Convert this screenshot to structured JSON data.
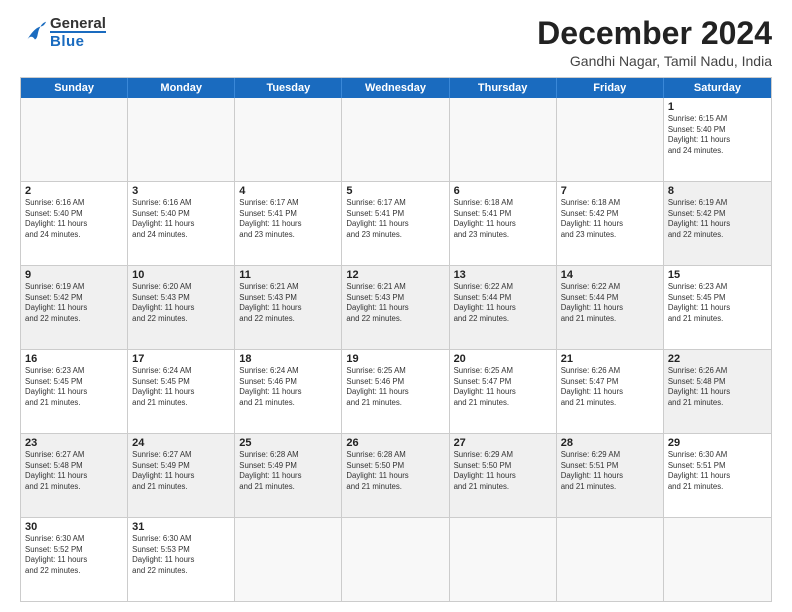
{
  "header": {
    "logo_general": "General",
    "logo_blue": "Blue",
    "title": "December 2024",
    "subtitle": "Gandhi Nagar, Tamil Nadu, India"
  },
  "calendar": {
    "days": [
      "Sunday",
      "Monday",
      "Tuesday",
      "Wednesday",
      "Thursday",
      "Friday",
      "Saturday"
    ],
    "weeks": [
      [
        {
          "day": "",
          "empty": true
        },
        {
          "day": "",
          "empty": true
        },
        {
          "day": "",
          "empty": true
        },
        {
          "day": "",
          "empty": true
        },
        {
          "day": "",
          "empty": true
        },
        {
          "day": "",
          "empty": true
        },
        {
          "day": "",
          "empty": true
        }
      ]
    ],
    "cells": [
      {
        "date": "",
        "lines": [],
        "empty": true
      },
      {
        "date": "",
        "lines": [],
        "empty": true
      },
      {
        "date": "",
        "lines": [],
        "empty": true
      },
      {
        "date": "",
        "lines": [],
        "empty": true
      },
      {
        "date": "",
        "lines": [],
        "empty": true
      },
      {
        "date": "",
        "lines": [],
        "empty": true
      },
      {
        "date": "1",
        "lines": [
          "Sunrise: 6:15 AM",
          "Sunset: 5:40 PM",
          "Daylight: 11 hours",
          "and 24 minutes."
        ]
      },
      {
        "date": "2",
        "lines": [
          "Sunrise: 6:16 AM",
          "Sunset: 5:40 PM",
          "Daylight: 11 hours",
          "and 24 minutes."
        ]
      },
      {
        "date": "3",
        "lines": [
          "Sunrise: 6:16 AM",
          "Sunset: 5:40 PM",
          "Daylight: 11 hours",
          "and 24 minutes."
        ]
      },
      {
        "date": "4",
        "lines": [
          "Sunrise: 6:17 AM",
          "Sunset: 5:41 PM",
          "Daylight: 11 hours",
          "and 23 minutes."
        ]
      },
      {
        "date": "5",
        "lines": [
          "Sunrise: 6:17 AM",
          "Sunset: 5:41 PM",
          "Daylight: 11 hours",
          "and 23 minutes."
        ]
      },
      {
        "date": "6",
        "lines": [
          "Sunrise: 6:18 AM",
          "Sunset: 5:41 PM",
          "Daylight: 11 hours",
          "and 23 minutes."
        ]
      },
      {
        "date": "7",
        "lines": [
          "Sunrise: 6:18 AM",
          "Sunset: 5:42 PM",
          "Daylight: 11 hours",
          "and 23 minutes."
        ]
      },
      {
        "date": "8",
        "lines": [
          "Sunrise: 6:19 AM",
          "Sunset: 5:42 PM",
          "Daylight: 11 hours",
          "and 22 minutes."
        ],
        "shaded": true
      },
      {
        "date": "9",
        "lines": [
          "Sunrise: 6:19 AM",
          "Sunset: 5:42 PM",
          "Daylight: 11 hours",
          "and 22 minutes."
        ],
        "shaded": true
      },
      {
        "date": "10",
        "lines": [
          "Sunrise: 6:20 AM",
          "Sunset: 5:43 PM",
          "Daylight: 11 hours",
          "and 22 minutes."
        ],
        "shaded": true
      },
      {
        "date": "11",
        "lines": [
          "Sunrise: 6:21 AM",
          "Sunset: 5:43 PM",
          "Daylight: 11 hours",
          "and 22 minutes."
        ],
        "shaded": true
      },
      {
        "date": "12",
        "lines": [
          "Sunrise: 6:21 AM",
          "Sunset: 5:43 PM",
          "Daylight: 11 hours",
          "and 22 minutes."
        ],
        "shaded": true
      },
      {
        "date": "13",
        "lines": [
          "Sunrise: 6:22 AM",
          "Sunset: 5:44 PM",
          "Daylight: 11 hours",
          "and 22 minutes."
        ],
        "shaded": true
      },
      {
        "date": "14",
        "lines": [
          "Sunrise: 6:22 AM",
          "Sunset: 5:44 PM",
          "Daylight: 11 hours",
          "and 21 minutes."
        ],
        "shaded": true
      },
      {
        "date": "15",
        "lines": [
          "Sunrise: 6:23 AM",
          "Sunset: 5:45 PM",
          "Daylight: 11 hours",
          "and 21 minutes."
        ]
      },
      {
        "date": "16",
        "lines": [
          "Sunrise: 6:23 AM",
          "Sunset: 5:45 PM",
          "Daylight: 11 hours",
          "and 21 minutes."
        ]
      },
      {
        "date": "17",
        "lines": [
          "Sunrise: 6:24 AM",
          "Sunset: 5:45 PM",
          "Daylight: 11 hours",
          "and 21 minutes."
        ]
      },
      {
        "date": "18",
        "lines": [
          "Sunrise: 6:24 AM",
          "Sunset: 5:46 PM",
          "Daylight: 11 hours",
          "and 21 minutes."
        ]
      },
      {
        "date": "19",
        "lines": [
          "Sunrise: 6:25 AM",
          "Sunset: 5:46 PM",
          "Daylight: 11 hours",
          "and 21 minutes."
        ]
      },
      {
        "date": "20",
        "lines": [
          "Sunrise: 6:25 AM",
          "Sunset: 5:47 PM",
          "Daylight: 11 hours",
          "and 21 minutes."
        ]
      },
      {
        "date": "21",
        "lines": [
          "Sunrise: 6:26 AM",
          "Sunset: 5:47 PM",
          "Daylight: 11 hours",
          "and 21 minutes."
        ]
      },
      {
        "date": "22",
        "lines": [
          "Sunrise: 6:26 AM",
          "Sunset: 5:48 PM",
          "Daylight: 11 hours",
          "and 21 minutes."
        ],
        "shaded": true
      },
      {
        "date": "23",
        "lines": [
          "Sunrise: 6:27 AM",
          "Sunset: 5:48 PM",
          "Daylight: 11 hours",
          "and 21 minutes."
        ],
        "shaded": true
      },
      {
        "date": "24",
        "lines": [
          "Sunrise: 6:27 AM",
          "Sunset: 5:49 PM",
          "Daylight: 11 hours",
          "and 21 minutes."
        ],
        "shaded": true
      },
      {
        "date": "25",
        "lines": [
          "Sunrise: 6:28 AM",
          "Sunset: 5:49 PM",
          "Daylight: 11 hours",
          "and 21 minutes."
        ],
        "shaded": true
      },
      {
        "date": "26",
        "lines": [
          "Sunrise: 6:28 AM",
          "Sunset: 5:50 PM",
          "Daylight: 11 hours",
          "and 21 minutes."
        ],
        "shaded": true
      },
      {
        "date": "27",
        "lines": [
          "Sunrise: 6:29 AM",
          "Sunset: 5:50 PM",
          "Daylight: 11 hours",
          "and 21 minutes."
        ],
        "shaded": true
      },
      {
        "date": "28",
        "lines": [
          "Sunrise: 6:29 AM",
          "Sunset: 5:51 PM",
          "Daylight: 11 hours",
          "and 21 minutes."
        ],
        "shaded": true
      },
      {
        "date": "29",
        "lines": [
          "Sunrise: 6:30 AM",
          "Sunset: 5:51 PM",
          "Daylight: 11 hours",
          "and 21 minutes."
        ]
      },
      {
        "date": "30",
        "lines": [
          "Sunrise: 6:30 AM",
          "Sunset: 5:52 PM",
          "Daylight: 11 hours",
          "and 22 minutes."
        ]
      },
      {
        "date": "31",
        "lines": [
          "Sunrise: 6:30 AM",
          "Sunset: 5:53 PM",
          "Daylight: 11 hours",
          "and 22 minutes."
        ]
      },
      {
        "date": "",
        "lines": [],
        "empty": true
      },
      {
        "date": "",
        "lines": [],
        "empty": true
      },
      {
        "date": "",
        "lines": [],
        "empty": true
      },
      {
        "date": "",
        "lines": [],
        "empty": true
      }
    ]
  }
}
